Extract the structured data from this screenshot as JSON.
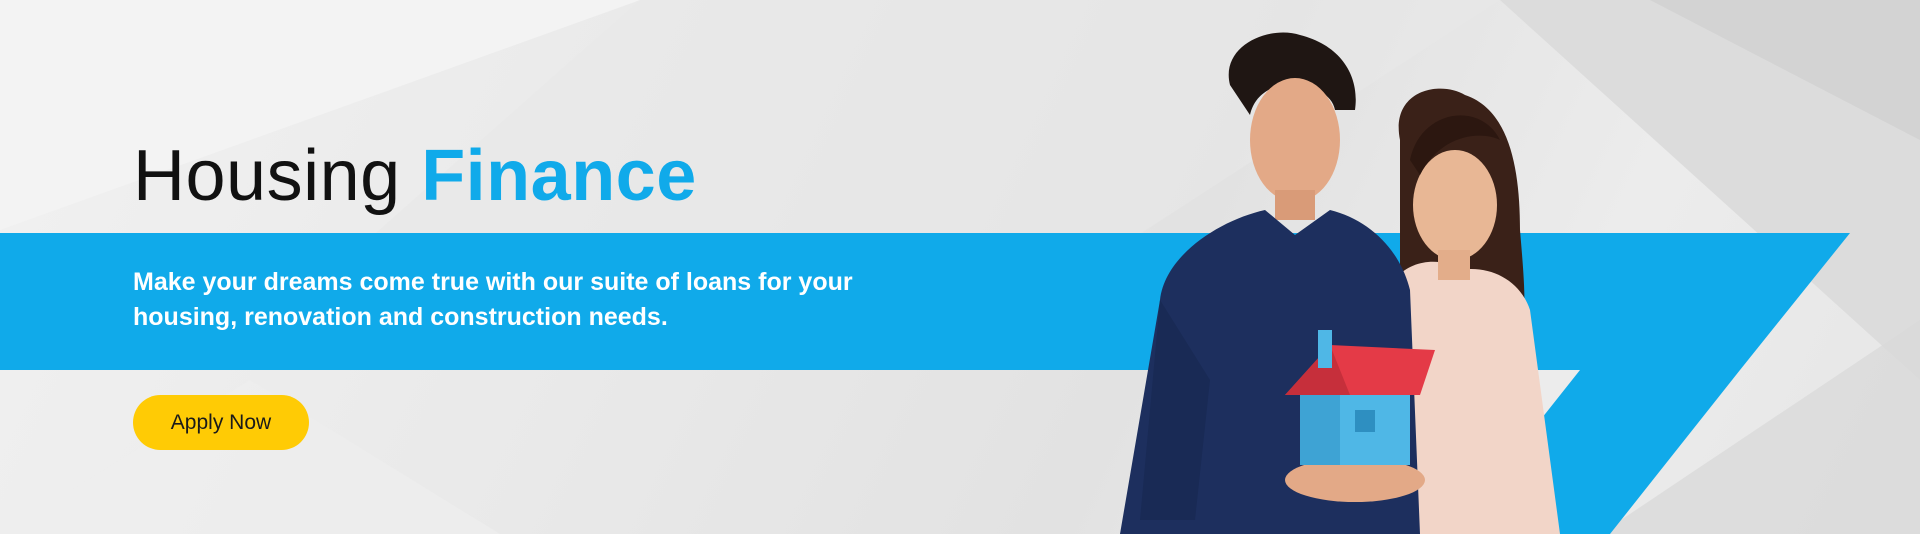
{
  "hero": {
    "title_prefix": "Housing",
    "title_accent": "Finance",
    "description": "Make your dreams come true with our suite of loans for your housing, renovation and construction needs.",
    "cta_label": "Apply Now"
  },
  "colors": {
    "accent_blue": "#10aaea",
    "cta_yellow": "#ffcb05",
    "title_dark": "#111111",
    "background_gray": "#e8e8e8"
  },
  "icons": {
    "house_model": "house-model-icon"
  }
}
